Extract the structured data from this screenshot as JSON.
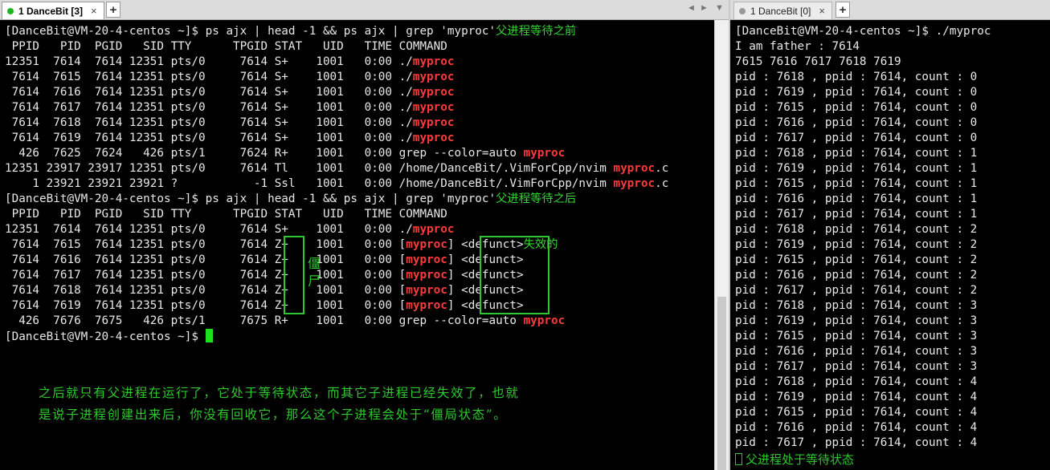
{
  "tabs": {
    "left": {
      "label": "1 DanceBit [3]"
    },
    "right": {
      "label": "1 DanceBit [0]"
    },
    "close_glyph": "×",
    "plus_glyph": "+",
    "nav_prev": "◄",
    "nav_next": "►",
    "nav_menu": "▼"
  },
  "left_terminal": {
    "lines": [
      [
        {
          "t": "[DanceBit@VM-20-4-centos ~]$ ps ajx | head -1 && ps ajx | grep 'myproc'"
        },
        {
          "t": "父进程等待之前",
          "c": "green"
        }
      ],
      [
        {
          "t": " PPID   PID  PGID   SID TTY      TPGID STAT   UID   TIME COMMAND"
        }
      ],
      [
        {
          "t": "12351  7614  7614 12351 pts/0     7614 S+    1001   0:00 ./"
        },
        {
          "t": "myproc",
          "c": "red"
        }
      ],
      [
        {
          "t": " 7614  7615  7614 12351 pts/0     7614 S+    1001   0:00 ./"
        },
        {
          "t": "myproc",
          "c": "red"
        }
      ],
      [
        {
          "t": " 7614  7616  7614 12351 pts/0     7614 S+    1001   0:00 ./"
        },
        {
          "t": "myproc",
          "c": "red"
        }
      ],
      [
        {
          "t": " 7614  7617  7614 12351 pts/0     7614 S+    1001   0:00 ./"
        },
        {
          "t": "myproc",
          "c": "red"
        }
      ],
      [
        {
          "t": " 7614  7618  7614 12351 pts/0     7614 S+    1001   0:00 ./"
        },
        {
          "t": "myproc",
          "c": "red"
        }
      ],
      [
        {
          "t": " 7614  7619  7614 12351 pts/0     7614 S+    1001   0:00 ./"
        },
        {
          "t": "myproc",
          "c": "red"
        }
      ],
      [
        {
          "t": "  426  7625  7624   426 pts/1     7624 R+    1001   0:00 grep --color=auto "
        },
        {
          "t": "myproc",
          "c": "red"
        }
      ],
      [
        {
          "t": "12351 23917 23917 12351 pts/0     7614 Tl    1001   0:00 /home/DanceBit/.VimForCpp/nvim "
        },
        {
          "t": "myproc",
          "c": "red"
        },
        {
          "t": ".c"
        }
      ],
      [
        {
          "t": "    1 23921 23921 23921 ?           -1 Ssl   1001   0:00 /home/DanceBit/.VimForCpp/nvim "
        },
        {
          "t": "myproc",
          "c": "red"
        },
        {
          "t": ".c"
        }
      ],
      [
        {
          "t": "[DanceBit@VM-20-4-centos ~]$ ps ajx | head -1 && ps ajx | grep 'myproc'"
        },
        {
          "t": "父进程等待之后",
          "c": "green"
        }
      ],
      [
        {
          "t": " PPID   PID  PGID   SID TTY      TPGID STAT   UID   TIME COMMAND"
        }
      ],
      [
        {
          "t": "12351  7614  7614 12351 pts/0     7614 S+    1001   0:00 ./"
        },
        {
          "t": "myproc",
          "c": "red"
        }
      ],
      [
        {
          "t": " 7614  7615  7614 12351 pts/0     7614 Z+    1001   0:00 ["
        },
        {
          "t": "myproc",
          "c": "red"
        },
        {
          "t": "] <defunct>"
        },
        {
          "t": "失效的",
          "c": "green"
        }
      ],
      [
        {
          "t": " 7614  7616  7614 12351 pts/0     7614 Z+    1001   0:00 ["
        },
        {
          "t": "myproc",
          "c": "red"
        },
        {
          "t": "] <defunct>"
        }
      ],
      [
        {
          "t": " 7614  7617  7614 12351 pts/0     7614 Z+    1001   0:00 ["
        },
        {
          "t": "myproc",
          "c": "red"
        },
        {
          "t": "] <defunct>"
        }
      ],
      [
        {
          "t": " 7614  7618  7614 12351 pts/0     7614 Z+    1001   0:00 ["
        },
        {
          "t": "myproc",
          "c": "red"
        },
        {
          "t": "] <defunct>"
        }
      ],
      [
        {
          "t": " 7614  7619  7614 12351 pts/0     7614 Z+    1001   0:00 ["
        },
        {
          "t": "myproc",
          "c": "red"
        },
        {
          "t": "] <defunct>"
        }
      ],
      [
        {
          "t": "  426  7676  7675   426 pts/1     7675 R+    1001   0:00 grep --color=auto "
        },
        {
          "t": "myproc",
          "c": "red"
        }
      ],
      [
        {
          "t": "[DanceBit@VM-20-4-centos ~]$ "
        },
        {
          "t": "",
          "c": "cursor"
        }
      ]
    ],
    "zombie_note": "僵尸",
    "comment_line1": "之后就只有父进程在运行了，它处于等待状态，而其它子进程已经失效了，也就",
    "comment_line2": "是说子进程创建出来后，你没有回收它，那么这个子进程会处于“僵局状态”。"
  },
  "right_terminal": {
    "lines": [
      "[DanceBit@VM-20-4-centos ~]$ ./myproc",
      "I am father : 7614",
      "7615 7616 7617 7618 7619",
      "pid : 7618 , ppid : 7614, count : 0",
      "pid : 7619 , ppid : 7614, count : 0",
      "pid : 7615 , ppid : 7614, count : 0",
      "pid : 7616 , ppid : 7614, count : 0",
      "pid : 7617 , ppid : 7614, count : 0",
      "pid : 7618 , ppid : 7614, count : 1",
      "pid : 7619 , ppid : 7614, count : 1",
      "pid : 7615 , ppid : 7614, count : 1",
      "pid : 7616 , ppid : 7614, count : 1",
      "pid : 7617 , ppid : 7614, count : 1",
      "pid : 7618 , ppid : 7614, count : 2",
      "pid : 7619 , ppid : 7614, count : 2",
      "pid : 7615 , ppid : 7614, count : 2",
      "pid : 7616 , ppid : 7614, count : 2",
      "pid : 7617 , ppid : 7614, count : 2",
      "pid : 7618 , ppid : 7614, count : 3",
      "pid : 7619 , ppid : 7614, count : 3",
      "pid : 7615 , ppid : 7614, count : 3",
      "pid : 7616 , ppid : 7614, count : 3",
      "pid : 7617 , ppid : 7614, count : 3",
      "pid : 7618 , ppid : 7614, count : 4",
      "pid : 7619 , ppid : 7614, count : 4",
      "pid : 7615 , ppid : 7614, count : 4",
      "pid : 7616 , ppid : 7614, count : 4",
      "pid : 7617 , ppid : 7614, count : 4"
    ],
    "bottom_note": "父进程处于等待状态"
  },
  "colors": {
    "accent_green": "#2ec82e",
    "highlight_red": "#ff3a3a",
    "terminal_bg": "#000000",
    "terminal_fg": "#e8e8e8"
  }
}
